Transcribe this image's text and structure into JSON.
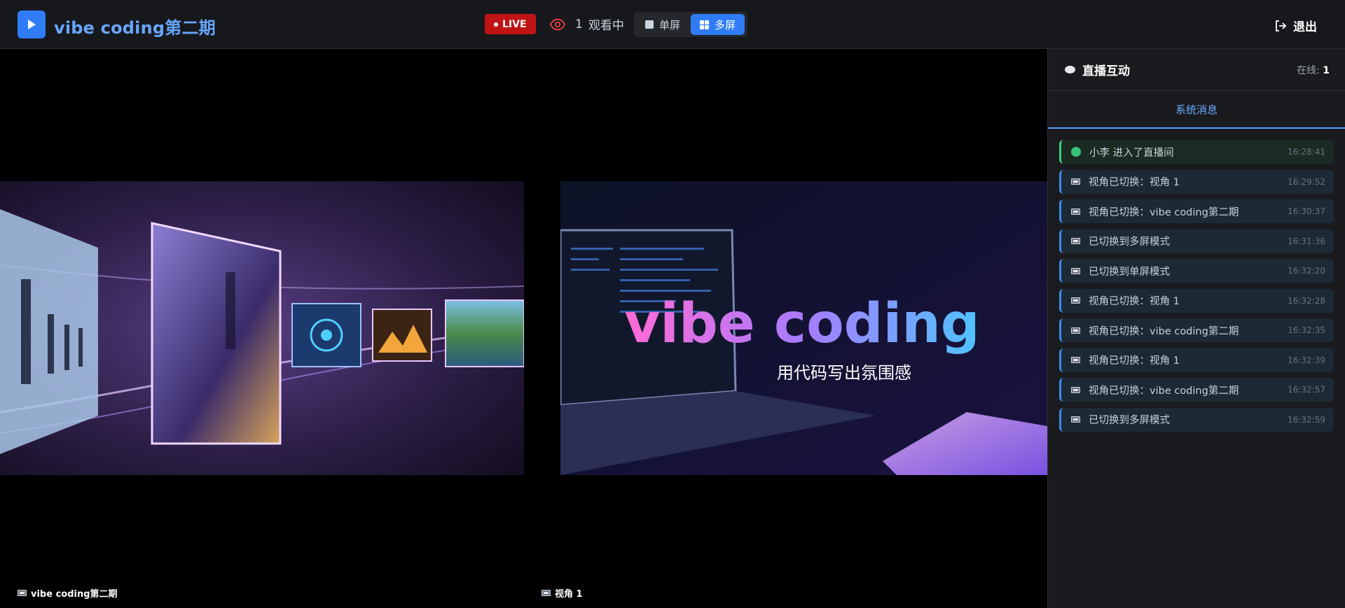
{
  "header": {
    "title": "vibe coding第二期",
    "live_label": "LIVE",
    "viewer_count": "1",
    "viewer_label": "观看中",
    "toggle": {
      "single_label": "单屏",
      "multi_label": "多屏",
      "active": "multi"
    },
    "logout_label": "退出"
  },
  "videos": [
    {
      "label": "vibe coding第二期"
    },
    {
      "label": "视角 1",
      "overlay_title": "vibe coding",
      "overlay_subtitle": "用代码写出氛围感"
    }
  ],
  "side": {
    "title": "直播互动",
    "online_label": "在线: ",
    "online_count": "1",
    "tab_label": "系统消息",
    "messages": [
      {
        "type": "join",
        "text": "小李 进入了直播间",
        "time": "16:28:41"
      },
      {
        "type": "system",
        "text": "视角已切换：视角 1",
        "time": "16:29:52"
      },
      {
        "type": "system",
        "text": "视角已切换：vibe coding第二期",
        "time": "16:30:37"
      },
      {
        "type": "system",
        "text": "已切换到多屏模式",
        "time": "16:31:36"
      },
      {
        "type": "system",
        "text": "已切换到单屏模式",
        "time": "16:32:20"
      },
      {
        "type": "system",
        "text": "视角已切换：视角 1",
        "time": "16:32:28"
      },
      {
        "type": "system",
        "text": "视角已切换：vibe coding第二期",
        "time": "16:32:35"
      },
      {
        "type": "system",
        "text": "视角已切换：视角 1",
        "time": "16:32:39"
      },
      {
        "type": "system",
        "text": "视角已切换：vibe coding第二期",
        "time": "16:32:57"
      },
      {
        "type": "system",
        "text": "已切换到多屏模式",
        "time": "16:32:59"
      }
    ]
  },
  "colors": {
    "accent": "#2f7cf6",
    "live": "#c01414",
    "join": "#3cd07a"
  }
}
